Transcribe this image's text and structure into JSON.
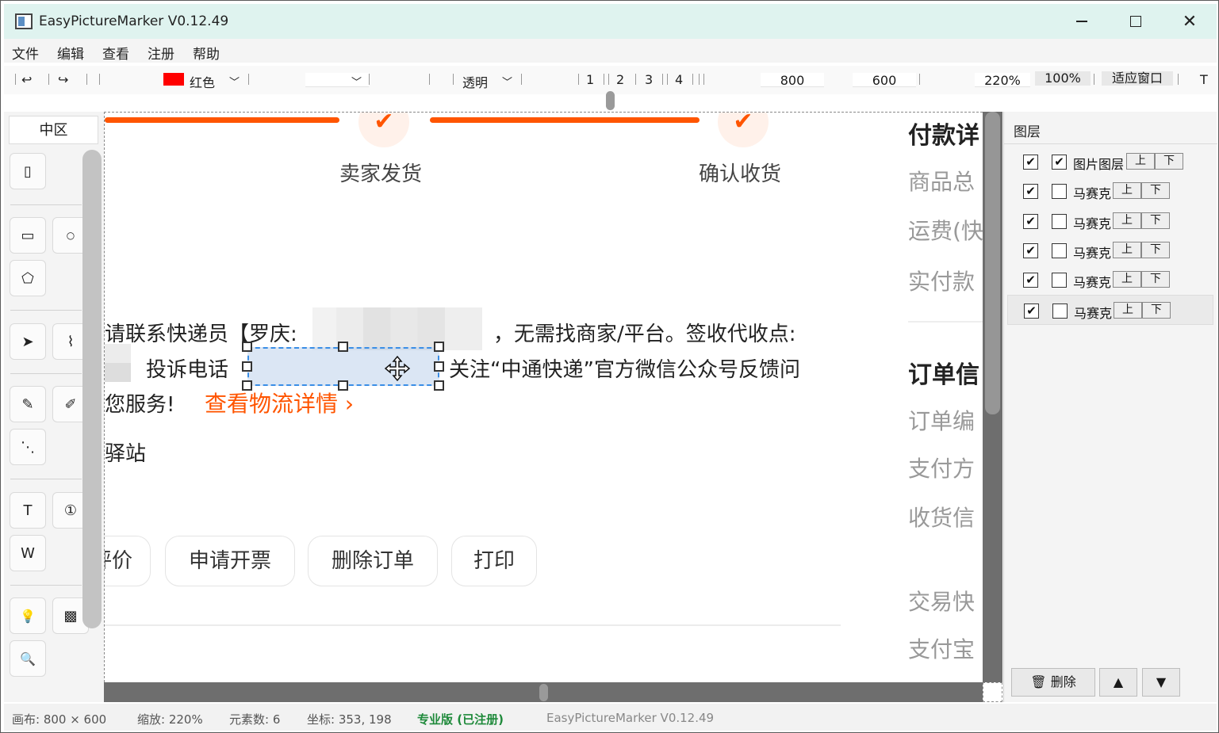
{
  "window": {
    "title": "EasyPictureMarker V0.12.49",
    "minimize": "minimize",
    "maximize": "maximize",
    "close": "✕"
  },
  "menu": [
    "文件",
    "编辑",
    "查看",
    "注册",
    "帮助"
  ],
  "toolbar": {
    "undo": "↩",
    "redo": "↪",
    "color_label": "红色",
    "color_value": "#ff0000",
    "fill_label": "透明",
    "numbers": [
      "1",
      "2",
      "3",
      "4"
    ],
    "width": "800",
    "height": "600",
    "zoom": "220%",
    "btn_100": "100%",
    "btn_fit": "适应窗口",
    "text_tool": "T"
  },
  "left_panel": {
    "zone_tab": "中区",
    "tools": [
      {
        "icon": "mouse-pointer-icon",
        "glyph": "▯"
      },
      {
        "icon": "rectangle-icon",
        "glyph": "▭"
      },
      {
        "icon": "circle-icon",
        "glyph": "○"
      },
      {
        "icon": "pentagon-icon",
        "glyph": "⬠"
      },
      {
        "icon": "arrow-icon",
        "glyph": "➤"
      },
      {
        "icon": "curve-icon",
        "glyph": "⌇"
      },
      {
        "icon": "pencil-icon",
        "glyph": "✎"
      },
      {
        "icon": "pen-icon",
        "glyph": "✐"
      },
      {
        "icon": "dots-icon",
        "glyph": "⋱"
      },
      {
        "icon": "text-icon",
        "glyph": "T"
      },
      {
        "icon": "number-icon",
        "glyph": "①"
      },
      {
        "icon": "watermark-icon",
        "glyph": "W"
      },
      {
        "icon": "bulb-icon",
        "glyph": "💡"
      },
      {
        "icon": "mosaic-icon",
        "glyph": "▩"
      },
      {
        "icon": "zoom-icon",
        "glyph": "🔍"
      }
    ]
  },
  "canvas": {
    "steps": [
      "卖家发货",
      "确认收货"
    ],
    "line1_a": "请联系快递员【罗庆:",
    "line1_b": "，无需找商家/平台。签收代收点:",
    "line2_a": "投诉电话",
    "line2_b": "关注“中通快递”官方微信公众号反馈问",
    "line3_a": "您服务!",
    "link": "查看物流详情 ›",
    "line4": "驿站",
    "buttons": [
      "评价",
      "申请开票",
      "删除订单",
      "打印"
    ],
    "right_col": {
      "heading1": "付款详",
      "items1": [
        "商品总",
        "运费(快",
        "实付款"
      ],
      "heading2": "订单信",
      "items2": [
        "订单编",
        "支付方",
        "收货信"
      ],
      "items3": [
        "交易快",
        "支付宝"
      ]
    }
  },
  "layers": {
    "title": "图层",
    "rows": [
      {
        "visible": true,
        "selected": true,
        "name": "图片图层",
        "up": "上",
        "down": "下"
      },
      {
        "visible": true,
        "selected": false,
        "name": "马赛克",
        "up": "上",
        "down": "下"
      },
      {
        "visible": true,
        "selected": false,
        "name": "马赛克",
        "up": "上",
        "down": "下"
      },
      {
        "visible": true,
        "selected": false,
        "name": "马赛克",
        "up": "上",
        "down": "下"
      },
      {
        "visible": true,
        "selected": false,
        "name": "马赛克",
        "up": "上",
        "down": "下"
      },
      {
        "visible": true,
        "selected": false,
        "name": "马赛克",
        "up": "上",
        "down": "下"
      }
    ],
    "delete_label": "删除",
    "up_btn": "▲",
    "down_btn": "▼"
  },
  "status": {
    "canvas": "画布:  800 × 600",
    "zoom": "缩放: 220%",
    "elements": "元素数: 6",
    "coords": "坐标: 353, 198",
    "edition": "专业版 (已注册)",
    "version": "EasyPictureMarker V0.12.49"
  },
  "colors": {
    "accent_orange": "#ff5500",
    "selection_blue": "#3a8ee6",
    "status_green": "#1f8a3b",
    "titlebar_bg": "#dff3ef"
  }
}
